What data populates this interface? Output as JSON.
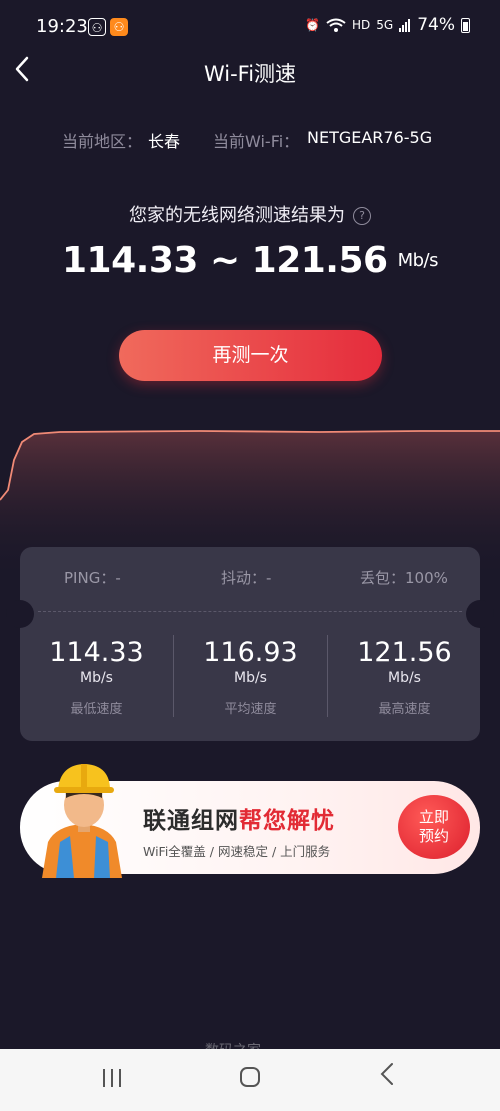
{
  "status_bar": {
    "time": "19:23",
    "battery": "74%",
    "network": "5G",
    "hd": "HD",
    "icons": [
      "app-icon",
      "app-icon",
      "alarm-icon",
      "wifi-icon",
      "signal-icon",
      "battery-icon"
    ]
  },
  "header": {
    "title": "Wi-Fi测速",
    "back_icon": "chevron-left-icon"
  },
  "info": {
    "region_label": "当前地区：",
    "region": "长春",
    "wifi_label": "当前Wi-Fi：",
    "wifi_name": "NETGEAR76-5G"
  },
  "result": {
    "headline": "您家的无线网络测速结果为",
    "help_icon": "question-circle-icon",
    "range": "114.33 ~ 121.56",
    "unit": "Mb/s"
  },
  "retest_label": "再测一次",
  "stats": {
    "ping": "PING：-",
    "jitter": "抖动：-",
    "loss": "丢包：100%",
    "min_value": "114.33",
    "min_unit": "Mb/s",
    "min_label": "最低速度",
    "avg_value": "116.93",
    "avg_unit": "Mb/s",
    "avg_label": "平均速度",
    "max_value": "121.56",
    "max_unit": "Mb/s",
    "max_label": "最高速度"
  },
  "banner": {
    "title_part1": "联通组网",
    "title_part2": "帮您解忧",
    "subtitle": "WiFi全覆盖 / 网速稳定 / 上门服务",
    "button_line1": "立即",
    "button_line2": "预约",
    "highlight_color": "#e22b35"
  },
  "watermark": "数码之家",
  "colors": {
    "background": "#1b1829",
    "accent": "#e52c3c",
    "card": "#393748"
  },
  "navbar": {
    "recent_icon": "recent-apps-icon",
    "home_icon": "home-icon",
    "back_icon": "back-icon"
  }
}
